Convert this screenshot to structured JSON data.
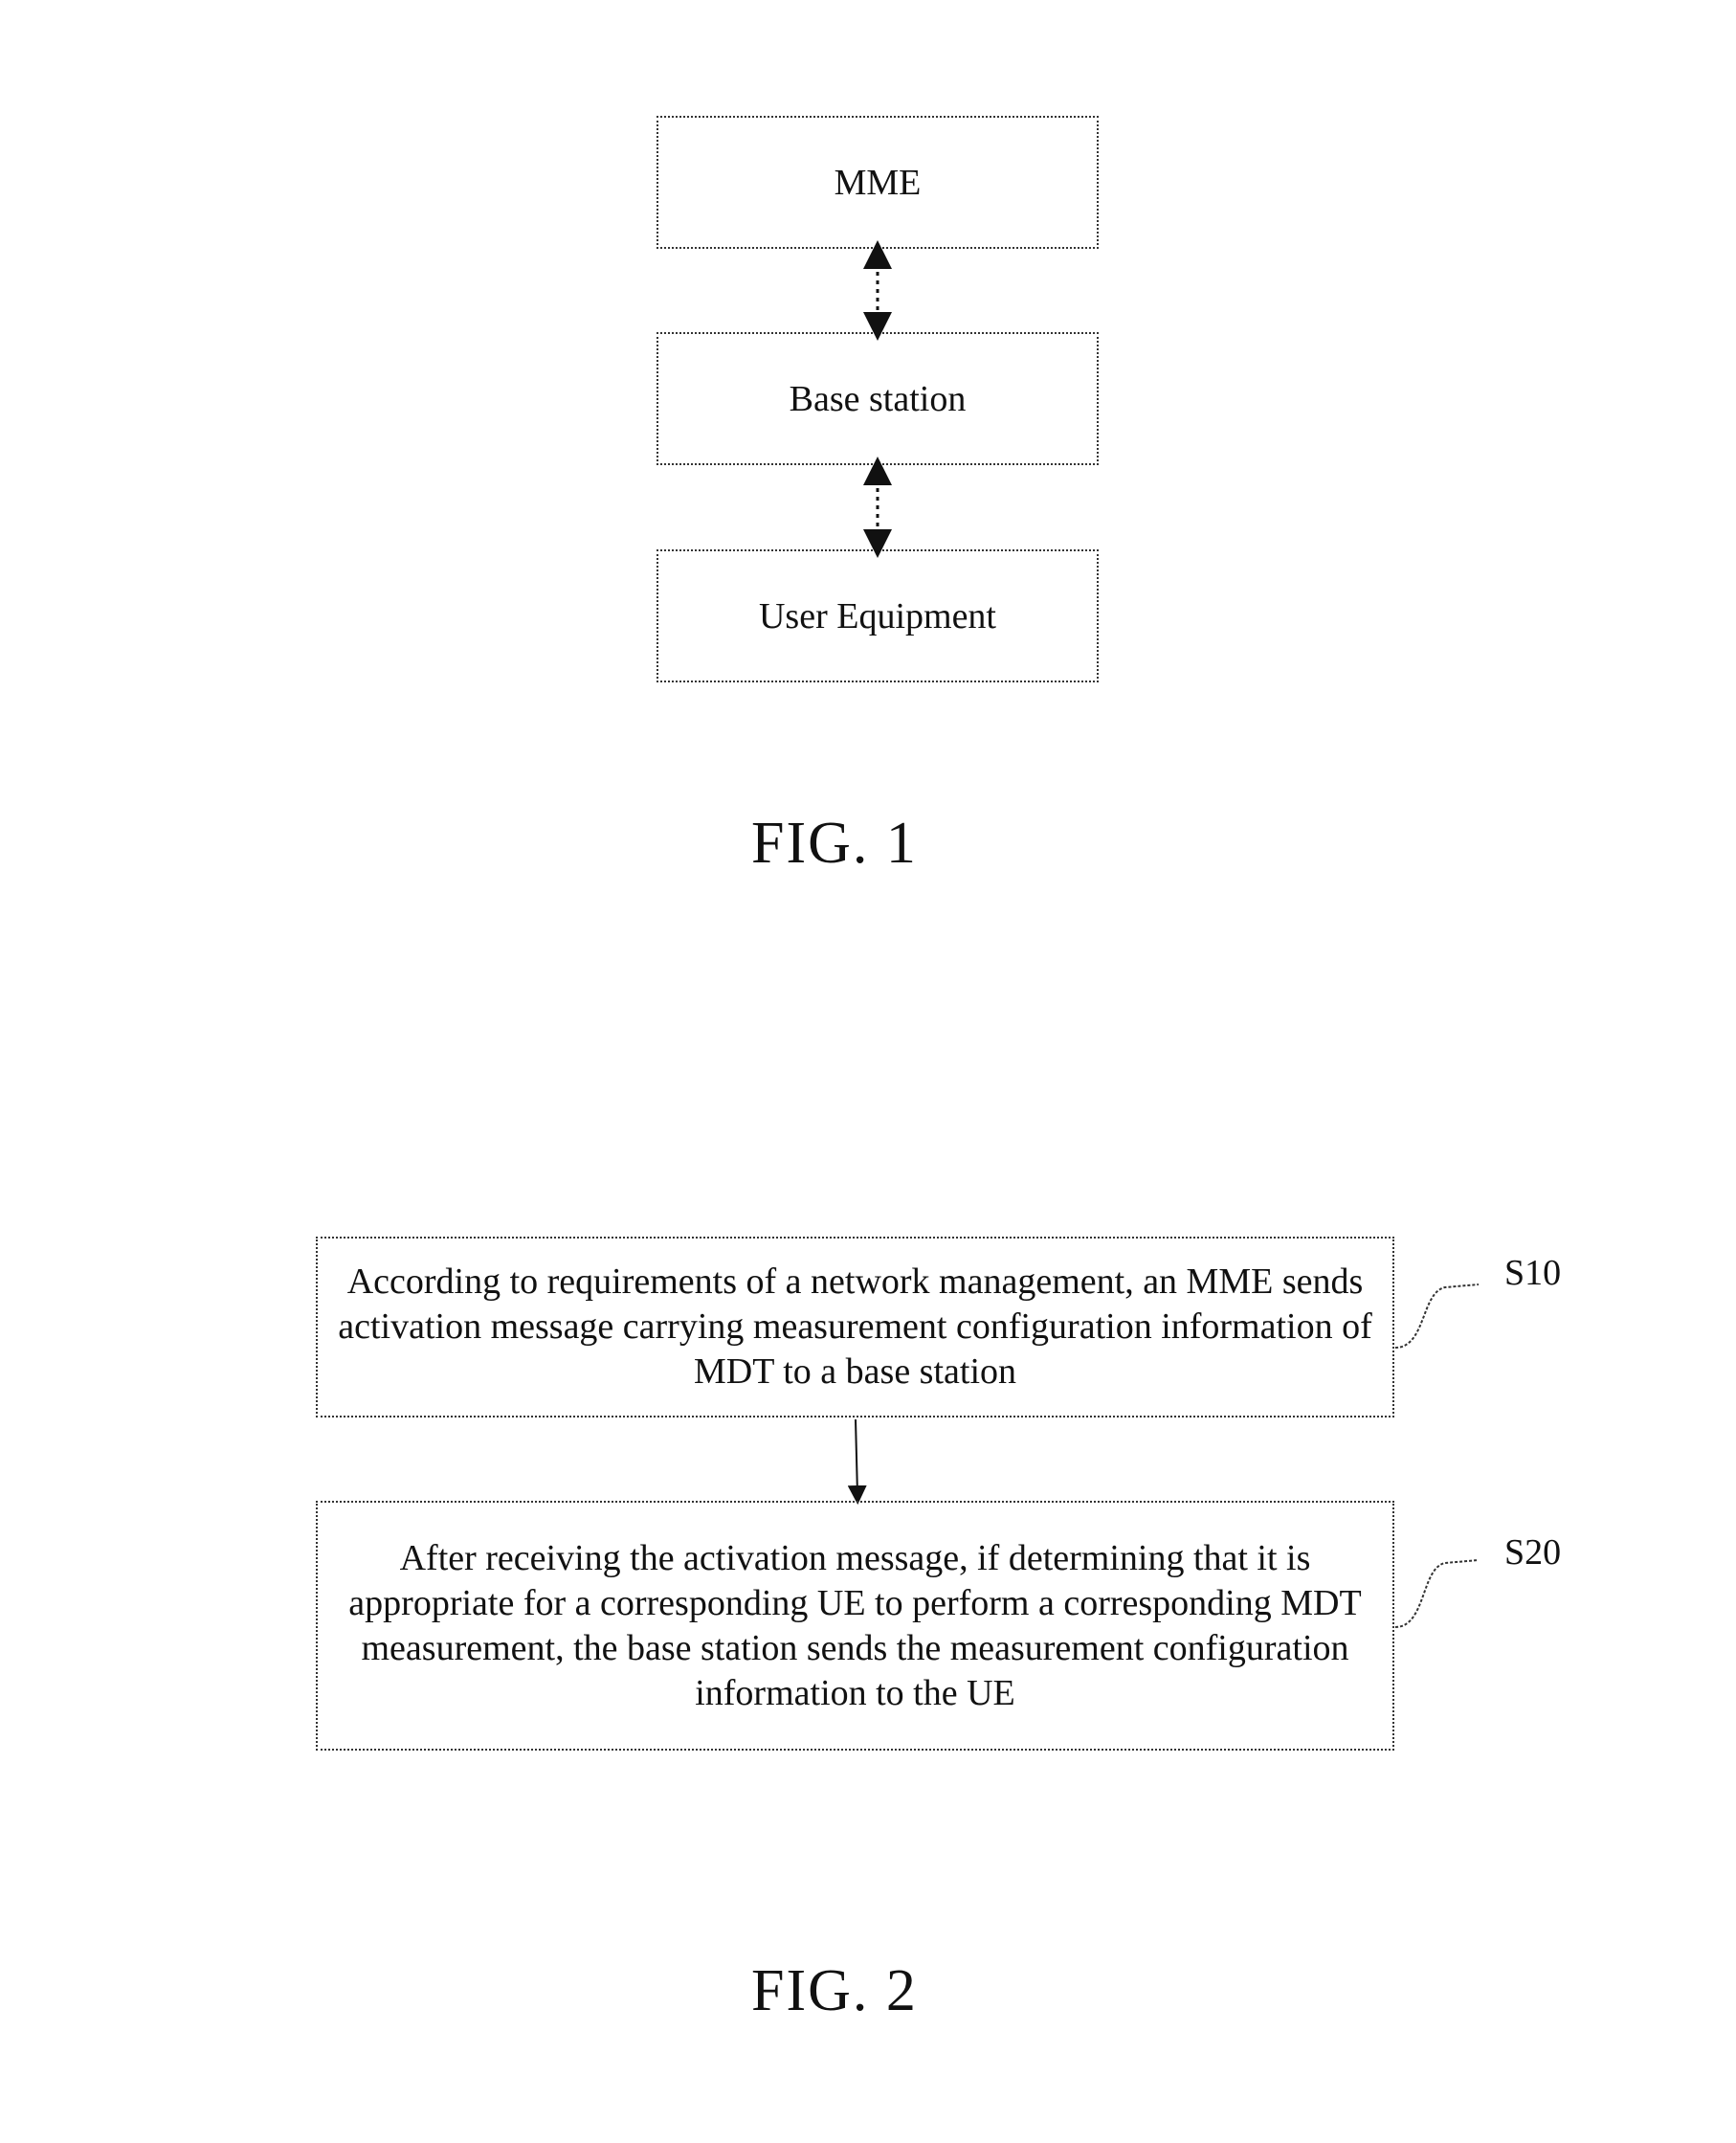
{
  "figure1": {
    "nodes": [
      {
        "label": "MME"
      },
      {
        "label": "Base station"
      },
      {
        "label": "User Equipment"
      }
    ],
    "connections": [
      {
        "from": "MME",
        "to": "Base station",
        "type": "bidirectional-dashed"
      },
      {
        "from": "Base station",
        "to": "User Equipment",
        "type": "bidirectional-dashed"
      }
    ],
    "caption": "FIG. 1"
  },
  "figure2": {
    "steps": [
      {
        "id": "S10",
        "text": "According to requirements of a network management, an MME sends activation message carrying measurement configuration information of MDT to a base station"
      },
      {
        "id": "S20",
        "text": "After receiving the activation message, if determining that it is appropriate for a corresponding UE to perform a corresponding MDT measurement, the base station sends the measurement configuration information to the UE"
      }
    ],
    "caption": "FIG. 2"
  }
}
